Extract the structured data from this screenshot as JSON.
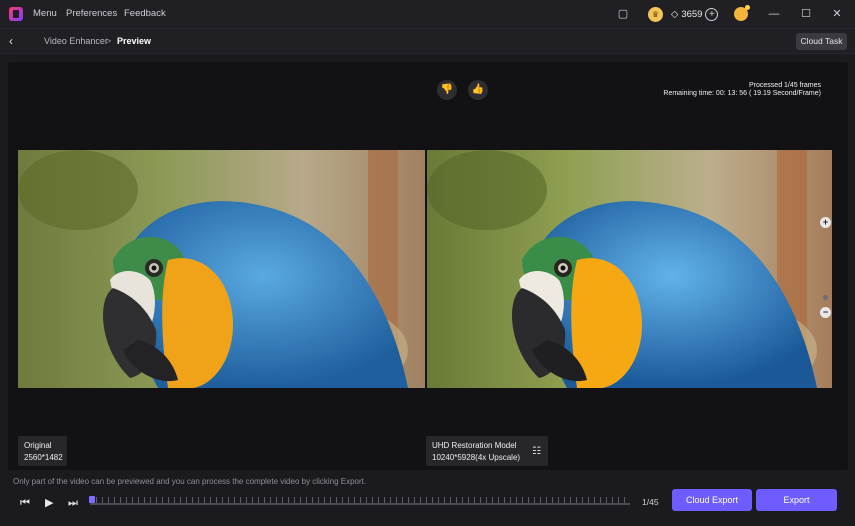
{
  "titlebar": {
    "menu_items": [
      "Menu",
      "Preferences",
      "Feedback"
    ],
    "credits": "3659",
    "icons": [
      "app-logo",
      "chat-icon",
      "crown-icon",
      "diamond-icon",
      "plus-icon",
      "avatar-icon",
      "minimize-icon",
      "maximize-icon",
      "close-icon"
    ],
    "glyphs": {
      "minimize": "—",
      "maximize": "☐",
      "close": "✕",
      "plus": "+",
      "chat": "▢",
      "diamond": "◇",
      "crown": "♛"
    }
  },
  "breadcrumb": {
    "parent": "Video Enhancer",
    "separator": ">",
    "current": "Preview",
    "back_glyph": "‹",
    "cloud_task_label": "Cloud Task"
  },
  "preview": {
    "processed": "Processed 1/45 frames",
    "remaining": "Remaining time: 00: 13: 56 ( 19.19 Second/Frame)",
    "dislike_glyph": "👎",
    "like_glyph": "👍",
    "zoom_in_glyph": "+",
    "zoom_out_glyph": "−",
    "original": {
      "title": "Original",
      "resolution": "2560*1482"
    },
    "enhanced": {
      "title": "UHD Restoration Model",
      "resolution": "10240*5928(4x Upscale)",
      "settings_glyph": "☷"
    }
  },
  "playback": {
    "notice": "Only part of the video can be previewed and you can process the complete video by clicking Export.",
    "prev_glyph": "⏮",
    "play_glyph": "▶",
    "next_glyph": "⏭",
    "frame_count": "1/45",
    "progress": 0.0
  },
  "actions": {
    "cloud_export_label": "Cloud Export",
    "export_label": "Export"
  },
  "colors": {
    "accent": "#6e5cff",
    "background": "#1b1b1f",
    "preview_bg": "#121214"
  }
}
